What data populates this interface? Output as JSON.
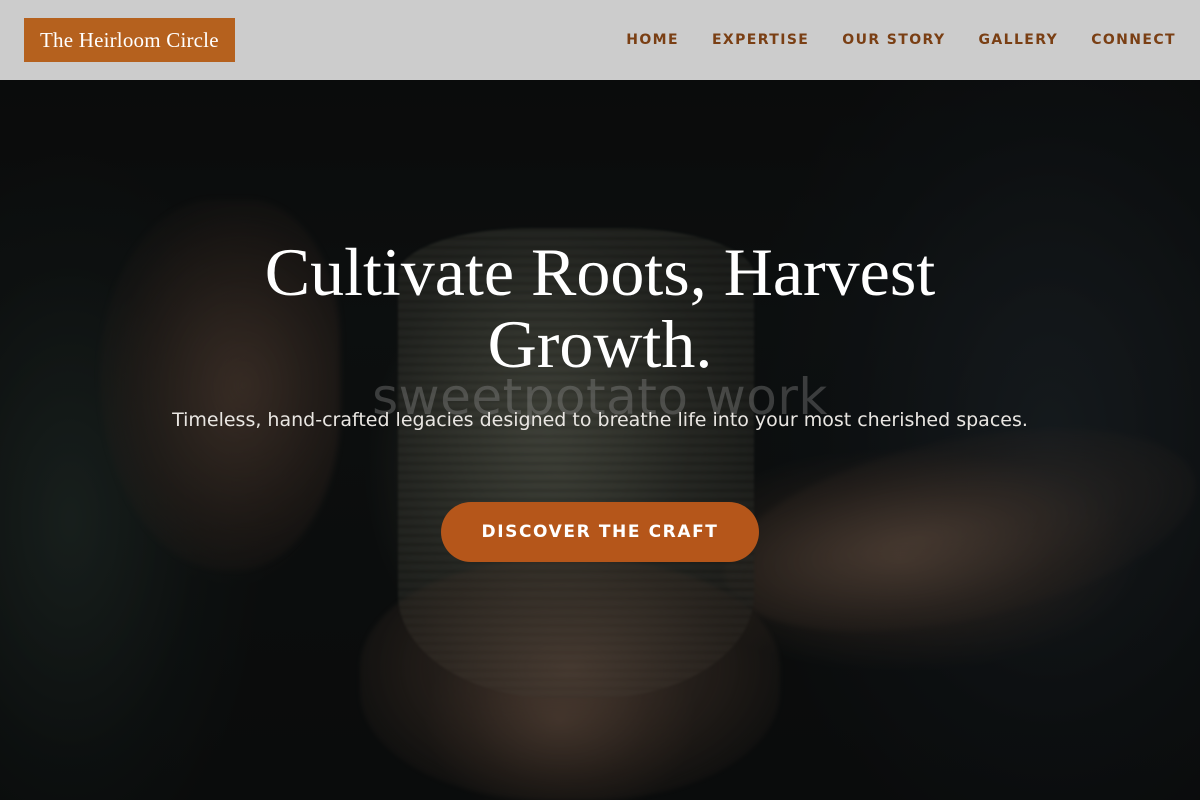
{
  "header": {
    "logo_text": "The Heirloom Circle",
    "nav": [
      {
        "label": "HOME"
      },
      {
        "label": "EXPERTISE"
      },
      {
        "label": "OUR STORY"
      },
      {
        "label": "GALLERY"
      },
      {
        "label": "CONNECT"
      }
    ]
  },
  "hero": {
    "headline": "Cultivate Roots, Harvest Growth.",
    "subheadline": "Timeless, hand-crafted legacies designed to breathe life into your most cherished spaces.",
    "cta_label": "DISCOVER THE CRAFT",
    "watermark_text": "sweetpotato work",
    "background_image": "hands-holding-ceramic-mug-photo"
  },
  "colors": {
    "accent": "#b5611e",
    "button": "#b5561a",
    "nav_text": "#7a3f14",
    "header_bg": "#d4d4d4"
  }
}
